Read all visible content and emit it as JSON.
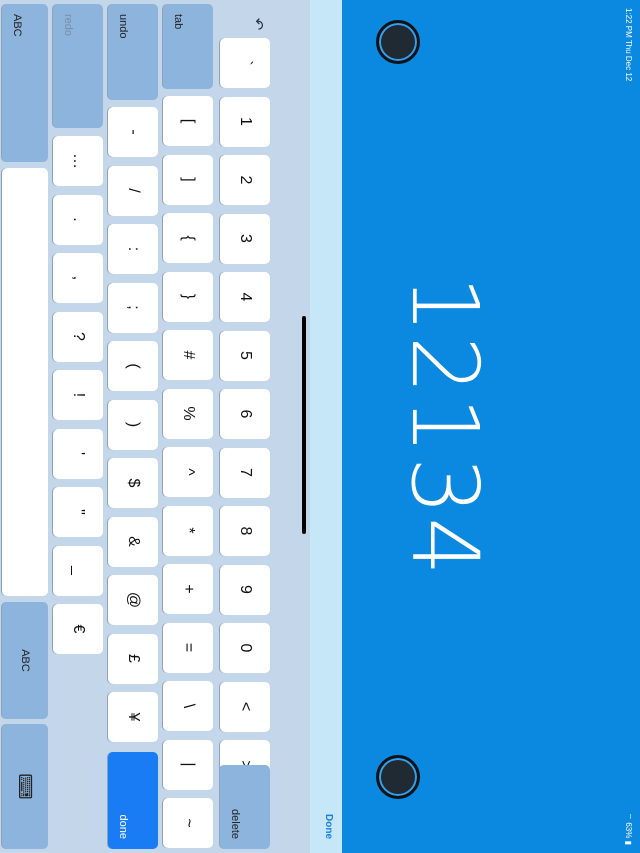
{
  "status_bar": {
    "time_date": "1:22 PM  Thu Dec 12",
    "battery": "63%"
  },
  "display": {
    "value": "12134"
  },
  "accessory": {
    "done_label": "Done"
  },
  "toolbar": {
    "undo_icon": "undo-arrow-icon",
    "redo_icon": "redo-arrow-icon",
    "paste_icon": "clipboard-icon"
  },
  "keyboard": {
    "row1": [
      "`",
      "1",
      "2",
      "3",
      "4",
      "5",
      "6",
      "7",
      "8",
      "9",
      "0",
      "<",
      ">"
    ],
    "row2": [
      "[",
      "]",
      "{",
      "}",
      "#",
      "%",
      "^",
      "*",
      "+",
      "=",
      "\\",
      "|",
      "~"
    ],
    "row3": [
      "-",
      "/",
      ":",
      ";",
      "(",
      ")",
      "$",
      "&",
      "@",
      "£",
      "¥"
    ],
    "row4": [
      "…",
      ".",
      ",",
      "?",
      "!",
      "'",
      "\"",
      "_",
      "€"
    ],
    "tab_label": "tab",
    "delete_label": "delete",
    "undo_label": "undo",
    "redo_label": "redo",
    "done_label": "done",
    "abc_left_label": "ABC",
    "abc_right_label": "ABC",
    "dismiss_icon": "keyboard-dismiss-icon"
  }
}
